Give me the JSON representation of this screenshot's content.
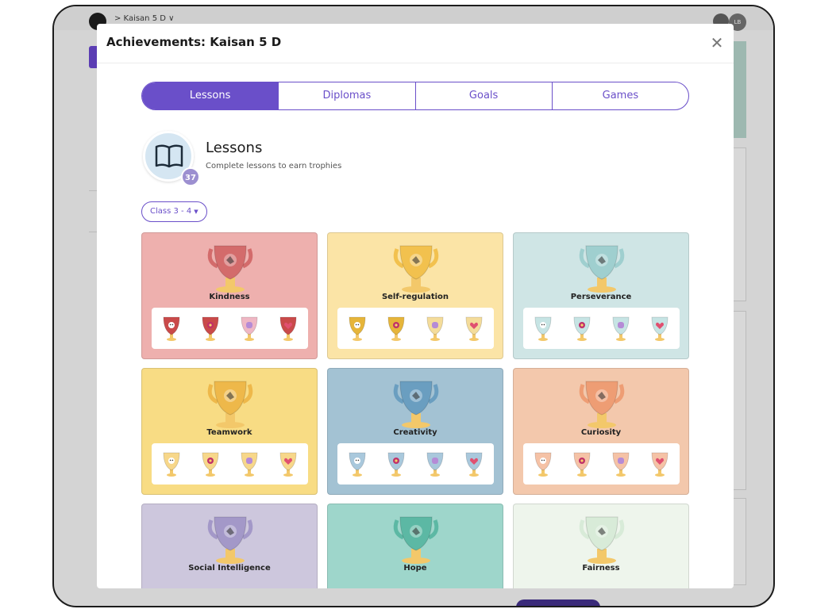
{
  "background": {
    "breadcrumb": "> Kaisan 5 D ∨",
    "avatar_initials": "LB"
  },
  "modal": {
    "title": "Achievements: Kaisan 5 D",
    "close_icon": "close-icon"
  },
  "tabs": [
    {
      "label": "Lessons",
      "active": true
    },
    {
      "label": "Diplomas",
      "active": false
    },
    {
      "label": "Goals",
      "active": false
    },
    {
      "label": "Games",
      "active": false
    }
  ],
  "section": {
    "icon": "book-icon",
    "count": "37",
    "title": "Lessons",
    "subtitle": "Complete lessons to earn trophies"
  },
  "class_filter": {
    "label": "Class 3 - 4"
  },
  "cards": [
    {
      "name": "Kindness",
      "bg": "#eeb0ae",
      "cup": "#d36b6b",
      "mini_colors": [
        "#c94a4a",
        "#c94a4a",
        "#efb7c4",
        "#c94a4a"
      ],
      "mini_icons": [
        "face",
        "flower",
        "hand",
        "heart"
      ]
    },
    {
      "name": "Self-regulation",
      "bg": "#fbe4a6",
      "cup": "#f2c14e",
      "mini_colors": [
        "#e6b53a",
        "#e6b53a",
        "#f4dc9a",
        "#f4dc9a"
      ],
      "mini_icons": [
        "face",
        "flower",
        "hand",
        "heart"
      ]
    },
    {
      "name": "Perseverance",
      "bg": "#cfe5e5",
      "cup": "#9fcfcf",
      "mini_colors": [
        "#c6e4e4",
        "#c6e4e4",
        "#c6e4e4",
        "#c6e4e4"
      ],
      "mini_icons": [
        "face",
        "flower",
        "hand",
        "heart"
      ]
    },
    {
      "name": "Teamwork",
      "bg": "#f8dc84",
      "cup": "#eeb84a",
      "mini_colors": [
        "#f7d78a",
        "#f7d78a",
        "#f7d78a",
        "#f7d78a"
      ],
      "mini_icons": [
        "face",
        "flower",
        "hand",
        "heart"
      ]
    },
    {
      "name": "Creativity",
      "bg": "#a3c2d3",
      "cup": "#6a9ec0",
      "mini_colors": [
        "#a9c8dc",
        "#a9c8dc",
        "#a9c8dc",
        "#a9c8dc"
      ],
      "mini_icons": [
        "face",
        "flower",
        "hand",
        "heart"
      ]
    },
    {
      "name": "Curiosity",
      "bg": "#f3c8ac",
      "cup": "#ee9d74",
      "mini_colors": [
        "#f5c2a6",
        "#f5c2a6",
        "#f5c2a6",
        "#f5c2a6"
      ],
      "mini_icons": [
        "face",
        "flower",
        "hand",
        "heart"
      ]
    },
    {
      "name": "Social Intelligence",
      "bg": "#cdc7dd",
      "cup": "#a398c8",
      "mini_colors": [],
      "mini_icons": []
    },
    {
      "name": "Hope",
      "bg": "#9ed6cb",
      "cup": "#5cb8a4",
      "mini_colors": [],
      "mini_icons": []
    },
    {
      "name": "Fairness",
      "bg": "#eef5ec",
      "cup": "#d8ebd8",
      "mini_colors": [],
      "mini_icons": []
    }
  ]
}
